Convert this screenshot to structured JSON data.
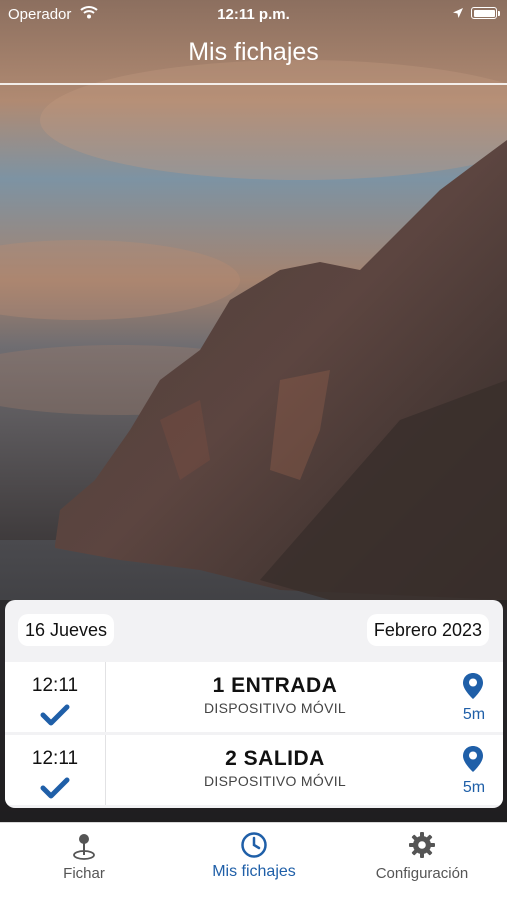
{
  "status_bar": {
    "carrier": "Operador",
    "time": "12:11 p.m."
  },
  "header": {
    "title": "Mis fichajes"
  },
  "records": {
    "day": "16 Jueves",
    "month": "Febrero 2023",
    "items": [
      {
        "time": "12:11",
        "title": "1  ENTRADA",
        "subtitle": "DISPOSITIVO MÓVIL",
        "distance": "5m"
      },
      {
        "time": "12:11",
        "title": "2  SALIDA",
        "subtitle": "DISPOSITIVO MÓVIL",
        "distance": "5m"
      }
    ]
  },
  "tabbar": {
    "tabs": [
      {
        "label": "Fichar",
        "icon": "map-pin-icon",
        "active": false
      },
      {
        "label": "Mis fichajes",
        "icon": "clock-icon",
        "active": true
      },
      {
        "label": "Configuración",
        "icon": "gear-icon",
        "active": false
      }
    ]
  },
  "colors": {
    "accent": "#1f5fa8",
    "card_bg": "#f2f2f4"
  }
}
